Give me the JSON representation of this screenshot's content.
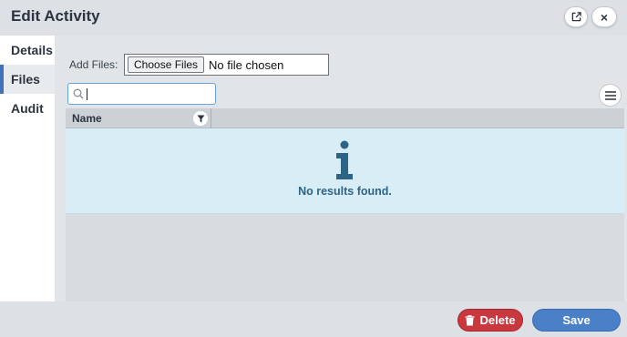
{
  "dialog": {
    "title": "Edit Activity",
    "popout_icon": "external-link-icon",
    "close_icon": "close-icon",
    "close_glyph": "×"
  },
  "tabs": [
    {
      "label": "Details",
      "active": false
    },
    {
      "label": "Files",
      "active": true
    },
    {
      "label": "Audit",
      "active": false
    }
  ],
  "files": {
    "add_label": "Add Files:",
    "choose_button": "Choose Files",
    "no_file_text": "No file chosen",
    "search_value": "",
    "search_icon": "search-icon",
    "menu_icon": "hamburger-menu-icon"
  },
  "grid": {
    "columns": [
      {
        "label": "Name",
        "filter_icon": "filter-icon"
      }
    ],
    "empty_icon": "info-icon",
    "empty_message": "No results found."
  },
  "footer": {
    "delete_label": "Delete",
    "delete_icon": "trash-icon",
    "save_label": "Save"
  },
  "colors": {
    "accent": "#4472b8",
    "delete": "#c8383e",
    "save": "#4a80c8",
    "info_text": "#2e6587"
  }
}
